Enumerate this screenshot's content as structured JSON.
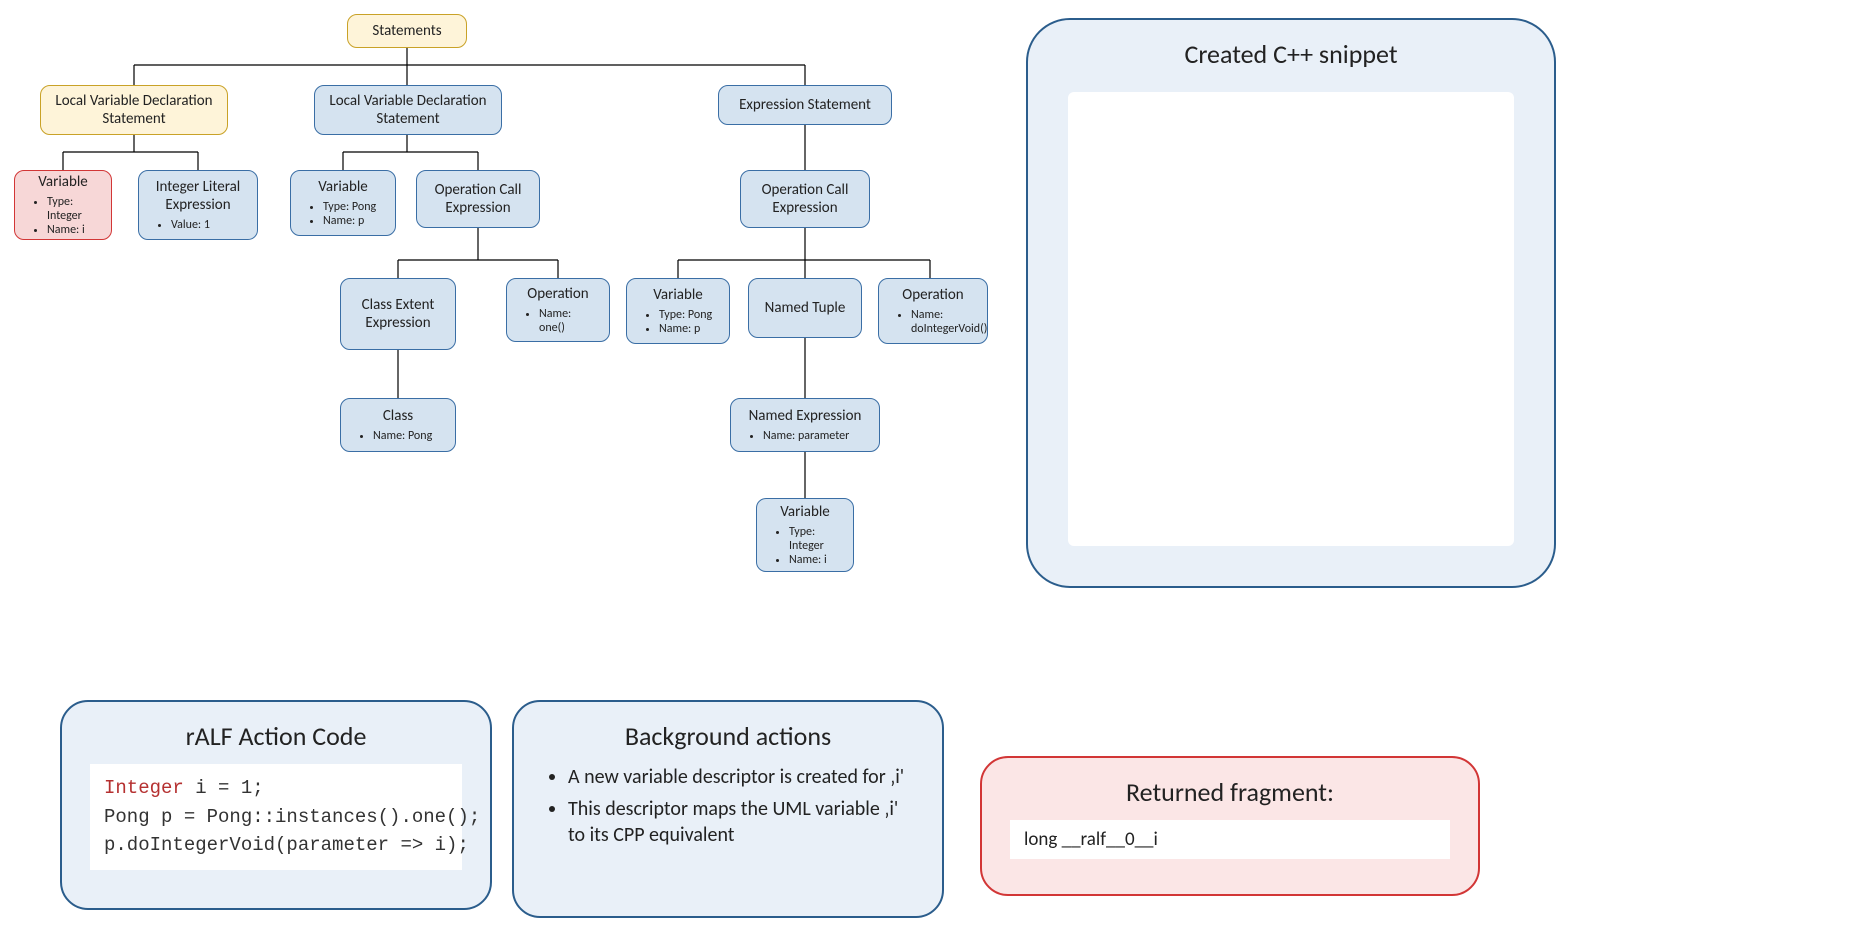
{
  "tree": {
    "root": "Statements",
    "lvd1": "Local Variable Declaration Statement",
    "lvd2": "Local Variable Declaration Statement",
    "expr_stmt": "Expression Statement",
    "var1_title": "Variable",
    "var1_a1": "Type: Integer",
    "var1_a2": "Name: i",
    "ile_title": "Integer Literal Expression",
    "ile_a1": "Value: 1",
    "var2_title": "Variable",
    "var2_a1": "Type: Pong",
    "var2_a2": "Name: p",
    "oce1": "Operation Call Expression",
    "cee": "Class Extent Expression",
    "op1_title": "Operation",
    "op1_a1": "Name: one()",
    "class_title": "Class",
    "class_a1": "Name: Pong",
    "oce2": "Operation Call Expression",
    "var3_title": "Variable",
    "var3_a1": "Type: Pong",
    "var3_a2": "Name: p",
    "ntuple": "Named Tuple",
    "op2_title": "Operation",
    "op2_a1": "Name: doIntegerVoid()",
    "nexpr_title": "Named Expression",
    "nexpr_a1": "Name: parameter",
    "var4_title": "Variable",
    "var4_a1": "Type: Integer",
    "var4_a2": "Name: i"
  },
  "panels": {
    "snippet_title": "Created C++ snippet",
    "ralf_title": "rALF Action Code",
    "ralf_kw": "Integer",
    "ralf_line1_rest": " i = 1;",
    "ralf_line2": "Pong p = Pong::instances().one();",
    "ralf_line3": "p.doIntegerVoid(parameter => i);",
    "bg_title": "Background actions",
    "bg_b1": "A new variable descriptor is created for ‚i'",
    "bg_b2": "This descriptor maps the UML variable ‚i' to its CPP equivalent",
    "ret_title": "Returned fragment:",
    "ret_body": "long __ralf__0__i"
  }
}
